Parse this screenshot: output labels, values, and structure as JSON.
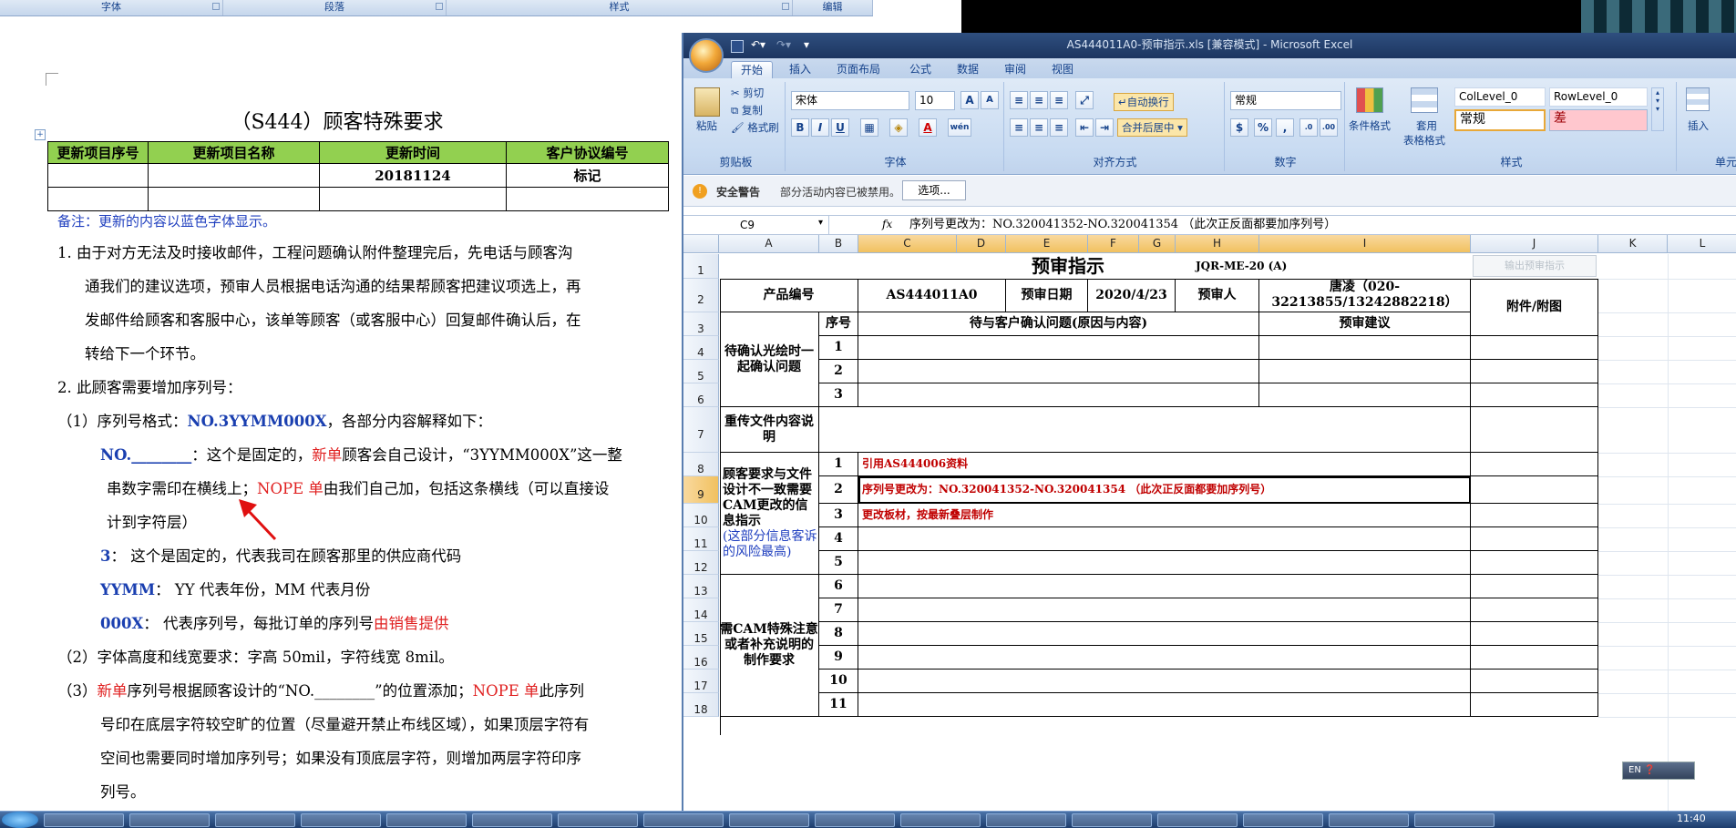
{
  "word": {
    "ribbon_groups": [
      "字体",
      "段落",
      "样式",
      "编辑"
    ],
    "title": "（S444）顾客特殊要求",
    "table": {
      "headers": [
        "更新项目序号",
        "更新项目名称",
        "更新时间",
        "客户协议编号"
      ],
      "rows": [
        [
          "",
          "",
          "20181124",
          "标记"
        ],
        [
          "",
          "",
          "",
          ""
        ]
      ]
    },
    "note": "备注：更新的内容以蓝色字体显示。",
    "p1": [
      "1.  由于对方无法及时接收邮件，工程问题确认附件整理完后，先电话与顾客沟",
      "通我们的建议选项，预审人员根据电话沟通的结果帮顾客把建议项选上，再",
      "发邮件给顾客和客服中心，该单等顾客（或客服中心）回复邮件确认后，在",
      "转给下一个环节。"
    ],
    "p2": "2.  此顾客需要增加序列号：",
    "s1_prefix": "（1）序列号格式：",
    "s1_fmt": "NO.3YYMM000X",
    "s1_suffix": "，各部分内容解释如下：",
    "no_label": "NO.________",
    "no_text1": "：这个是固定的，",
    "no_new": "新单",
    "no_text2": "顾客会自己设计，“3YYMM000X”这一整",
    "no_line2a": "串数字需印在横线上；",
    "no_nope": "NOPE 单",
    "no_line2b": "由我们自己加，包括这条横线（可以直接设",
    "no_line3": "计到字符层）",
    "three_label": "3",
    "three_text": "：  这个是固定的，代表我司在顾客那里的供应商代码",
    "yymm_label": "YYMM",
    "yymm_text": "：  YY 代表年份，MM 代表月份",
    "ooox_label": "000X",
    "ooox_text": "：  代表序列号，每批订单的序列号",
    "ooox_red": "由销售提供",
    "s2": "（2）字体高度和线宽要求：字高 50mil，字符线宽 8mil。",
    "s3_a": "（3）",
    "s3_new": "新单",
    "s3_b": "序列号根据顾客设计的“NO.________”的位置添加；",
    "s3_nope": "NOPE 单",
    "s3_c": "此序列",
    "s3_lines": [
      "号印在底层字符较空旷的位置（尽量避开禁止布线区域），如果顶层字符有",
      "空间也需要同时增加序列号；如果没有顶底层字符，则增加两层字符印序",
      "列号。"
    ]
  },
  "excel": {
    "title": "AS444011A0-预审指示.xls  [兼容模式]  -  Microsoft Excel",
    "tabs": [
      "开始",
      "插入",
      "页面布局",
      "公式",
      "数据",
      "审阅",
      "视图"
    ],
    "clipboard": {
      "paste": "粘贴",
      "cut": "剪切",
      "copy": "复制",
      "format_painter": "格式刷",
      "label": "剪贴板"
    },
    "font": {
      "name": "宋体",
      "size": "10",
      "label": "字体",
      "grow": "A",
      "shrink": "A",
      "bold": "B",
      "italic": "I",
      "underline": "U",
      "wen": "wén"
    },
    "align": {
      "wrap": "自动换行",
      "merge": "合并后居中",
      "label": "对齐方式"
    },
    "number": {
      "format": "常规",
      "label": "数字",
      "pct": "%",
      "comma": ","
    },
    "styles": {
      "cond": "条件格式",
      "table": "套用",
      "table2": "表格格式",
      "collevel": "ColLevel_0",
      "rowlevel": "RowLevel_0",
      "normal": "常规",
      "bad": "差",
      "label": "样式"
    },
    "cells": {
      "insert": "插入",
      "label": "单元"
    },
    "security": {
      "title": "安全警告",
      "message": "部分活动内容已被禁用。",
      "button": "选项..."
    },
    "namebox": "C9",
    "fx": "fx",
    "formula": "序列号更改为：NO.320041352-NO.320041354  （此次正反面都要加序列号）",
    "columns": [
      "A",
      "B",
      "C",
      "D",
      "E",
      "F",
      "G",
      "H",
      "I",
      "J",
      "K",
      "L"
    ],
    "rows": [
      "1",
      "2",
      "3",
      "4",
      "5",
      "6",
      "7",
      "8",
      "9",
      "10",
      "11",
      "12",
      "13",
      "14",
      "15",
      "16",
      "17",
      "18"
    ],
    "sheet": {
      "title": "预审指示",
      "docno": "JQR-ME-20 (A)",
      "btn": "输出预审指示",
      "product_label": "产品编号",
      "product": "AS444011A0",
      "date_label": "预审日期",
      "date": "2020/4/23",
      "reviewer_label": "预审人",
      "reviewer": "唐凌（020-32213855/13242882218）",
      "attach": "附件/附图",
      "seq": "序号",
      "question": "待与客户确认问题(原因与内容)",
      "advice": "预审建议",
      "sec1": "待确认光绘时一起确认问题",
      "sec2": "重传文件内容说明",
      "sec3a": "顾客要求与文件设计不一致需要CAM更改的信息指示",
      "sec3b": "(这部分信息客诉的风险最高)",
      "sec4": "需CAM特殊注意或者补充说明的制作要求",
      "nums": [
        "1",
        "2",
        "3",
        "1",
        "2",
        "3",
        "4",
        "5",
        "6",
        "7",
        "8",
        "9",
        "10",
        "11"
      ],
      "item1": "引用AS444006资料",
      "item2": "序列号更改为：NO.320041352-NO.320041354  （此次正反面都要加序列号）",
      "item3": "更改板材，按最新叠层制作"
    },
    "ime": "EN"
  },
  "taskbar": {
    "clock": "11:40"
  }
}
